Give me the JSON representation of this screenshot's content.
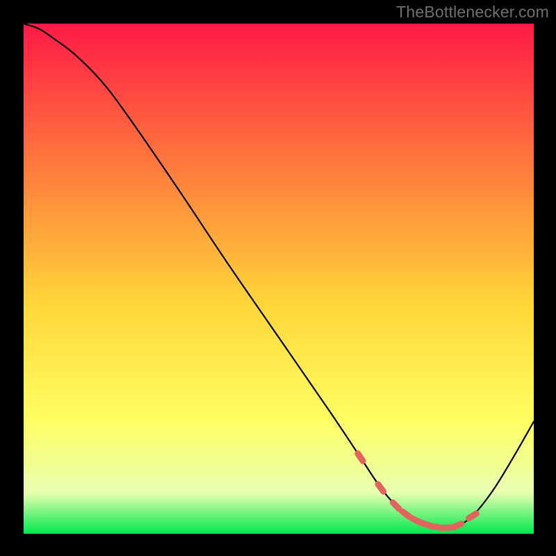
{
  "watermark": "TheBottlenecker.com",
  "colors": {
    "background": "#000000",
    "gradient_top": "#ff1a46",
    "gradient_mid1": "#ff7a3c",
    "gradient_mid2": "#ffd63a",
    "gradient_mid3": "#ffff64",
    "gradient_mid4": "#e8ffb0",
    "gradient_bottom": "#00e84d",
    "curve": "#000000",
    "marker": "#e2645e",
    "watermark": "#6f6f6f"
  },
  "chart_data": {
    "type": "line",
    "title": "",
    "xlabel": "",
    "ylabel": "",
    "xlim": [
      0,
      100
    ],
    "ylim": [
      0,
      100
    ],
    "series": [
      {
        "name": "bottleneck-curve",
        "x": [
          0,
          3,
          6,
          10,
          15,
          20,
          30,
          40,
          50,
          60,
          66,
          70,
          73,
          75,
          77,
          79,
          81,
          83,
          85,
          88,
          92,
          96,
          100
        ],
        "values": [
          100,
          99,
          97,
          94,
          89,
          82.5,
          68,
          53,
          38.5,
          24,
          15,
          9,
          5.5,
          3.8,
          2.6,
          1.8,
          1.3,
          1.2,
          1.6,
          3.5,
          8.5,
          15,
          22
        ]
      }
    ],
    "markers": {
      "name": "highlighted-range",
      "x": [
        66,
        70,
        73,
        75,
        77,
        79,
        81,
        83,
        85,
        88
      ],
      "values": [
        15,
        9,
        5.5,
        3.8,
        2.6,
        1.8,
        1.3,
        1.2,
        1.6,
        3.5
      ]
    },
    "annotations": []
  }
}
